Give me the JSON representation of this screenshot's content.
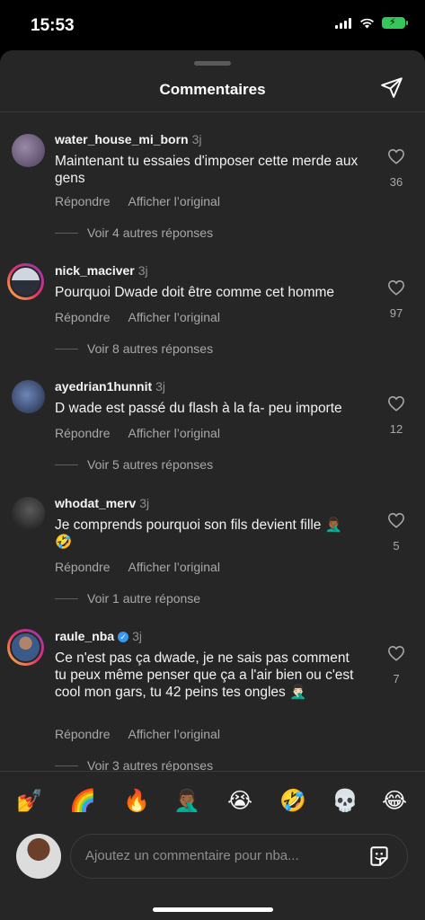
{
  "status_bar": {
    "time": "15:53"
  },
  "sheet": {
    "title": "Commentaires"
  },
  "comments": [
    {
      "username": "water_house_mi_born",
      "age": "3j",
      "verified": false,
      "text": "Maintenant tu essaies d'imposer cette merde aux gens",
      "reply": "Répondre",
      "translate": "Afficher l’original",
      "more_replies": "Voir 4 autres réponses",
      "likes": "36"
    },
    {
      "username": "nick_maciver",
      "age": "3j",
      "verified": false,
      "text": "Pourquoi Dwade doit être comme cet homme",
      "reply": "Répondre",
      "translate": "Afficher l’original",
      "more_replies": "Voir 8 autres réponses",
      "likes": "97"
    },
    {
      "username": "ayedrian1hunnit",
      "age": "3j",
      "verified": false,
      "text": "D wade est passé du flash à la fa- peu importe",
      "reply": "Répondre",
      "translate": "Afficher l’original",
      "more_replies": "Voir 5 autres réponses",
      "likes": "12"
    },
    {
      "username": "whodat_merv",
      "age": "3j",
      "verified": false,
      "text": "Je comprends pourquoi son fils devient fille 🤦🏾‍♂️ 🤣",
      "reply": "Répondre",
      "translate": "Afficher l’original",
      "more_replies": "Voir 1 autre réponse",
      "likes": "5"
    },
    {
      "username": "raule_nba",
      "age": "3j",
      "verified": true,
      "text": "Ce n'est pas ça dwade, je ne sais pas comment tu peux même penser que ça a l'air bien ou c'est cool mon gars, tu 42 peins tes ongles 🤦🏻‍♂️",
      "reply": "Répondre",
      "translate": "Afficher l’original",
      "more_replies": "Voir 3 autres réponses",
      "likes": "7"
    }
  ],
  "quick_emojis": [
    "💅",
    "🌈",
    "🔥",
    "🤦🏾‍♂️",
    "😭",
    "🤣",
    "💀",
    "😂"
  ],
  "composer": {
    "placeholder": "Ajoutez un commentaire pour nba..."
  }
}
